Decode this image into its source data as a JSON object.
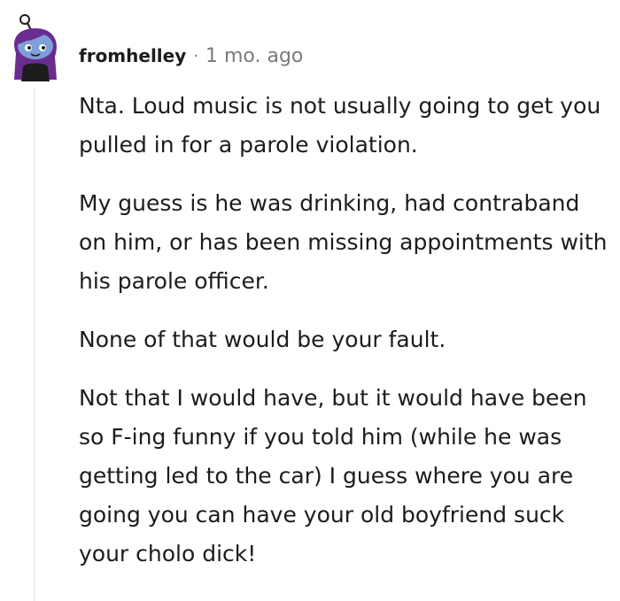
{
  "comment": {
    "username": "fromhelley",
    "separator": "·",
    "timestamp": "1 mo. ago",
    "paragraphs": [
      "Nta. Loud music is not usually going to get you pulled in for a parole violation.",
      "My guess is he was drinking, had contraband on him, or has been missing appointments with his parole officer.",
      "None of that would be your fault.",
      "Not that I would have, but it would have been so F-ing funny if you told him (while he was getting led to the car) I guess where you are going you can have your old boyfriend suck your cholo dick!"
    ]
  },
  "colors": {
    "text": "#1c1c1c",
    "meta": "#787c7e",
    "thread_line": "#edeff1",
    "avatar_hair": "#6a2c8e",
    "avatar_skin": "#7e9fd8",
    "avatar_body": "#1c1c1c"
  },
  "icons": {
    "avatar": "reddit-snoo-avatar"
  }
}
